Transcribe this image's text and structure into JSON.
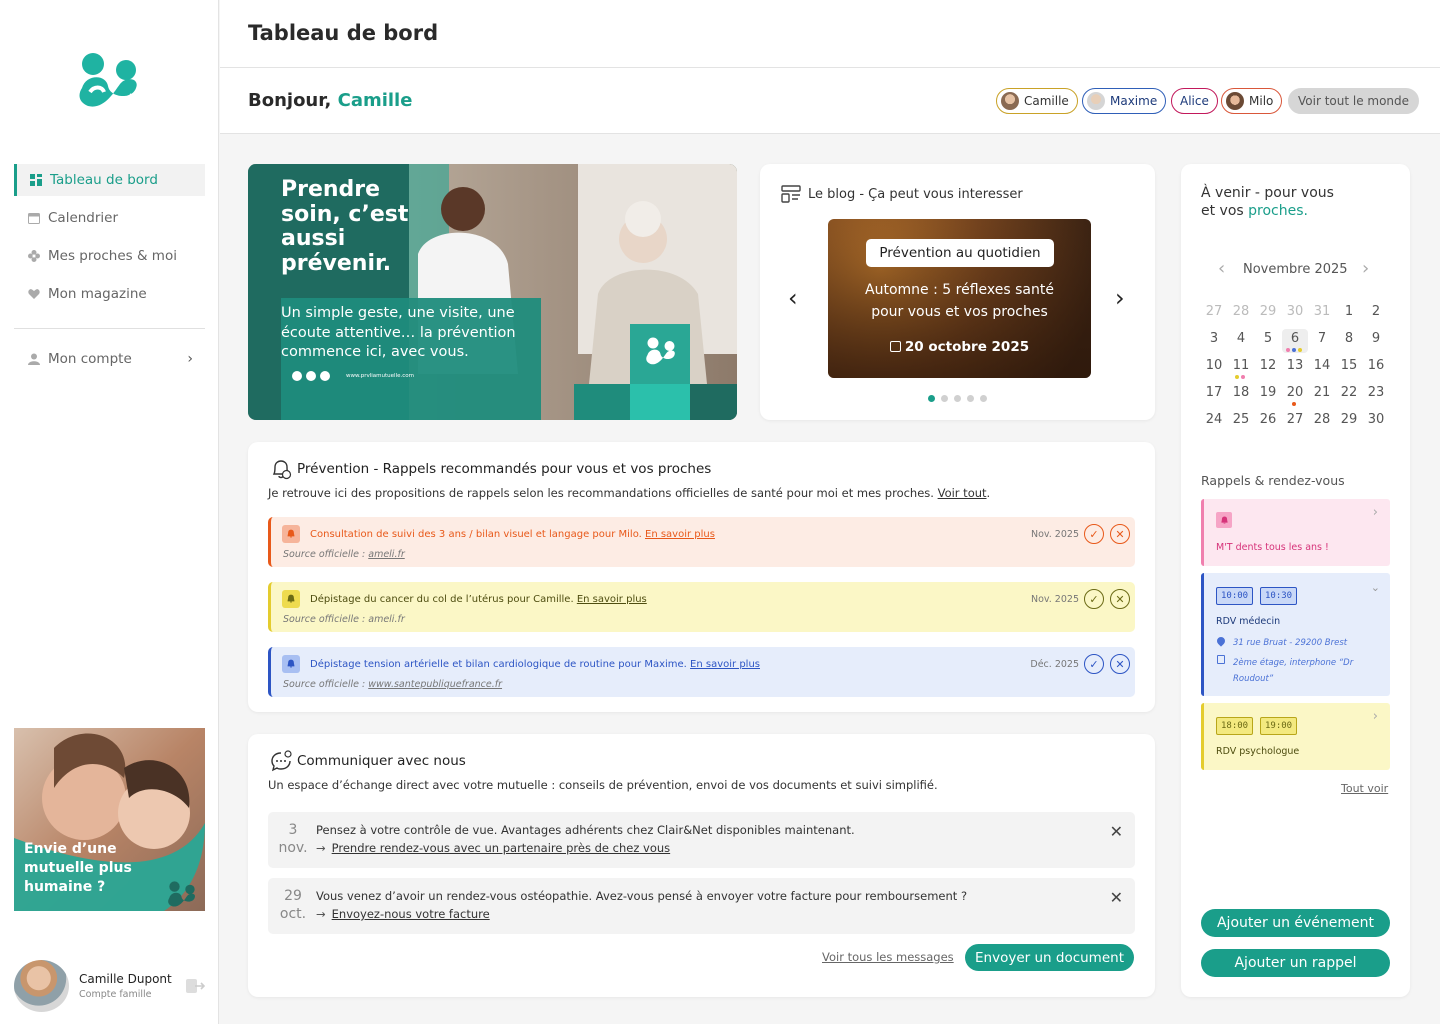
{
  "page": {
    "title": "Tableau de bord"
  },
  "greeting": {
    "prefix": "Bonjour,",
    "name": "Camille"
  },
  "people": [
    {
      "name": "Camille",
      "color": "#c9a227"
    },
    {
      "name": "Maxime",
      "color": "#2f5fb8"
    },
    {
      "name": "Alice",
      "color": "#c2185b"
    },
    {
      "name": "Milo",
      "color": "#d9573a"
    }
  ],
  "people_all_label": "Voir tout le monde",
  "sidebar": {
    "items": [
      {
        "label": "Tableau de bord",
        "icon": "grid-icon"
      },
      {
        "label": "Calendrier",
        "icon": "calendar-icon"
      },
      {
        "label": "Mes proches & moi",
        "icon": "flower-icon"
      },
      {
        "label": "Mon magazine",
        "icon": "heart-icon"
      },
      {
        "label": "Mon compte",
        "icon": "user-icon"
      }
    ],
    "promo_text": "Envie d’une mutuelle plus humaine ?",
    "user_name": "Camille Dupont",
    "user_role": "Compte famille"
  },
  "hero": {
    "title": "Prendre soin, c’est aussi prévenir.",
    "subtitle": "Un simple geste, une visite, une écoute attentive… la prévention commence ici, avec vous.",
    "url": "www.prvliamutuelle.com"
  },
  "blog": {
    "title": "Le blog - Ça peut vous interesser",
    "tag": "Prévention au quotidien",
    "headline": "Automne : 5 réflexes santé pour vous et vos proches",
    "date": "20 octobre 2025",
    "dots": 5,
    "active_dot": 0
  },
  "prevention": {
    "title": "Prévention - Rappels recommandés pour vous et vos proches",
    "intro": "Je retrouve ici des propositions de rappels selon les recommandations officielles de santé pour moi et mes proches.",
    "see_all": "Voir tout",
    "source_label": "Source officielle :",
    "more_label": "En savoir plus",
    "items": [
      {
        "text": "Consultation de suivi des 3 ans / bilan visuel et langage pour Milo.",
        "source": "ameli.fr",
        "date": "Nov. 2025",
        "color": "#e8591a",
        "bg": "#fdece4",
        "icon_bg": "#f6b49a"
      },
      {
        "text": "Dépistage du cancer du col de l’utérus pour Camille.",
        "source": "ameli.fr",
        "date": "Nov. 2025",
        "color": "#6b6a15",
        "bg": "#fbf7c6",
        "icon_bg": "#eedb4f"
      },
      {
        "text": "Dépistage tension artérielle et bilan cardiologique de routine pour Maxime.",
        "source": "www.santepubliquefrance.fr",
        "date": "Déc. 2025",
        "color": "#2d55c4",
        "bg": "#e6edfb",
        "icon_bg": "#a8bff2"
      }
    ]
  },
  "communicate": {
    "title": "Communiquer avec nous",
    "intro": "Un espace d’échange direct avec votre mutuelle : conseils de prévention, envoi de vos documents et suivi simplifié.",
    "messages": [
      {
        "day": "3",
        "month": "nov.",
        "text": "Pensez à votre contrôle de vue. Avantages adhérents chez Clair&Net disponibles maintenant.",
        "link": "Prendre rendez-vous avec un partenaire près de chez vous"
      },
      {
        "day": "29",
        "month": "oct.",
        "text": "Vous venez d’avoir un rendez-vous ostéopathie. Avez-vous pensé à envoyer votre facture pour remboursement ?",
        "link": "Envoyez-nous votre facture"
      }
    ],
    "all_messages": "Voir tous les messages",
    "send_doc": "Envoyer un document"
  },
  "upcoming": {
    "title_a": "À venir - pour vous",
    "title_b": "et vos",
    "title_highlight": "proches.",
    "month": "Novembre 2025",
    "weeks": [
      [
        [
          "27",
          1
        ],
        [
          "28",
          1
        ],
        [
          "29",
          1
        ],
        [
          "30",
          1
        ],
        [
          "31",
          1
        ],
        [
          "1",
          0
        ],
        [
          "2",
          0
        ]
      ],
      [
        [
          "3",
          0
        ],
        [
          "4",
          0
        ],
        [
          "5",
          0
        ],
        [
          "6",
          0
        ],
        [
          "7",
          0
        ],
        [
          "8",
          0
        ],
        [
          "9",
          0
        ]
      ],
      [
        [
          "10",
          0
        ],
        [
          "11",
          0
        ],
        [
          "12",
          0
        ],
        [
          "13",
          0
        ],
        [
          "14",
          0
        ],
        [
          "15",
          0
        ],
        [
          "16",
          0
        ]
      ],
      [
        [
          "17",
          0
        ],
        [
          "18",
          0
        ],
        [
          "19",
          0
        ],
        [
          "20",
          0
        ],
        [
          "21",
          0
        ],
        [
          "22",
          0
        ],
        [
          "23",
          0
        ]
      ],
      [
        [
          "24",
          0
        ],
        [
          "25",
          0
        ],
        [
          "26",
          0
        ],
        [
          "27",
          0
        ],
        [
          "28",
          0
        ],
        [
          "29",
          0
        ],
        [
          "30",
          0
        ]
      ]
    ],
    "today": "6",
    "reminders_title": "Rappels & rendez-vous",
    "appointments": [
      {
        "title": "M'T dents tous les ans !",
        "color": "#d6337a",
        "bg": "#fde7f0"
      },
      {
        "title": "RDV médecin",
        "start": "10:00",
        "end": "10:30",
        "address": "31 rue Bruat - 29200 Brest",
        "note": "2ème étage, interphone “Dr Roudout”",
        "color": "#2d55c4",
        "bg": "#e6edfb"
      },
      {
        "title": "RDV psychologue",
        "start": "18:00",
        "end": "19:00",
        "color": "#6b6a15",
        "bg": "#fbf7c6"
      }
    ],
    "see_all": "Tout voir",
    "add_event": "Ajouter un événement",
    "add_reminder": "Ajouter un rappel"
  },
  "colors": {
    "accent": "#1a9e8a",
    "accent_dark": "#1f6b60"
  }
}
